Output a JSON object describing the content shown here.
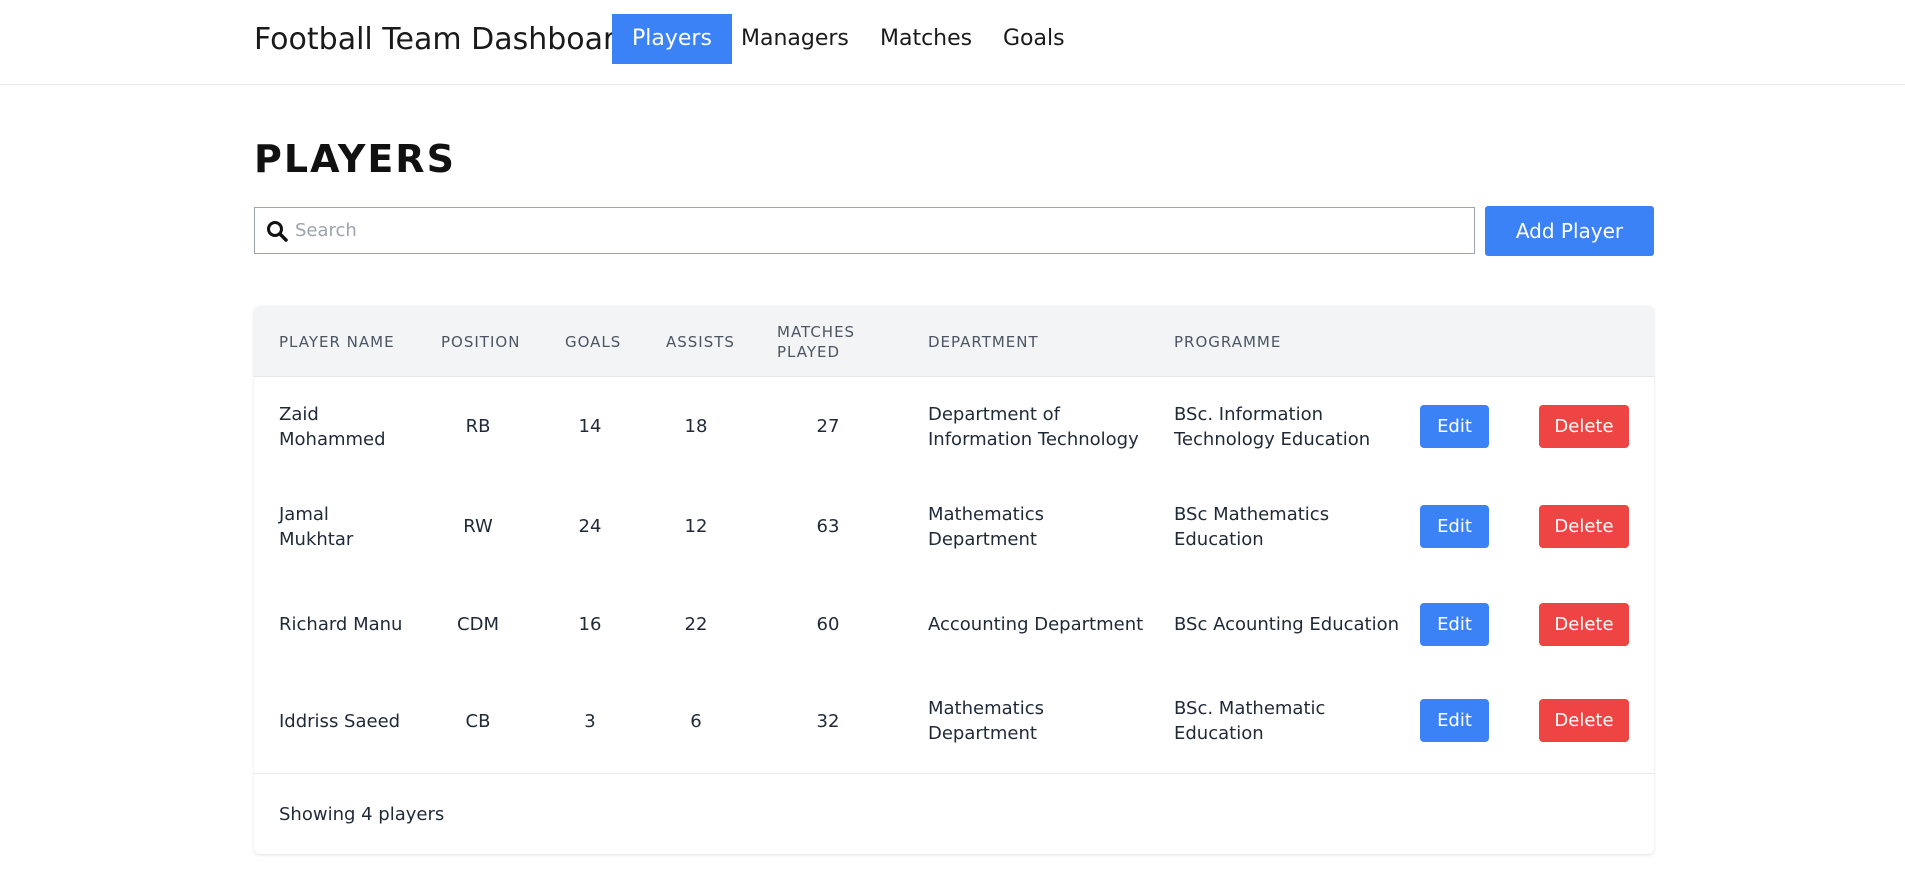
{
  "nav": {
    "brand": "Football Team Dashboard",
    "items": [
      {
        "label": "Players",
        "active": true
      },
      {
        "label": "Managers",
        "active": false
      },
      {
        "label": "Matches",
        "active": false
      },
      {
        "label": "Goals",
        "active": false
      }
    ]
  },
  "page": {
    "title": "PLAYERS"
  },
  "search": {
    "placeholder": "Search",
    "value": ""
  },
  "toolbar": {
    "add_label": "Add Player"
  },
  "table": {
    "headers": {
      "name": "PLAYER NAME",
      "position": "POSITION",
      "goals": "GOALS",
      "assists": "ASSISTS",
      "matches_line1": "MATCHES",
      "matches_line2": "PLAYED",
      "department": "DEPARTMENT",
      "programme": "PROGRAMME"
    },
    "rows": [
      {
        "name1": "Zaid",
        "name2": "Mohammed",
        "position": "RB",
        "goals": "14",
        "assists": "18",
        "matches": "27",
        "dept1": "Department of",
        "dept2": "Information Technology",
        "prog1": "BSc. Information",
        "prog2": "Technology Education",
        "edit": "Edit",
        "delete": "Delete"
      },
      {
        "name1": "Jamal",
        "name2": "Mukhtar",
        "position": "RW",
        "goals": "24",
        "assists": "12",
        "matches": "63",
        "dept1": "Mathematics",
        "dept2": "Department",
        "prog1": "BSc Mathematics",
        "prog2": "Education",
        "edit": "Edit",
        "delete": "Delete"
      },
      {
        "name1": "Richard Manu",
        "name2": "",
        "position": "CDM",
        "goals": "16",
        "assists": "22",
        "matches": "60",
        "dept1": "Accounting Department",
        "dept2": "",
        "prog1": "BSc Acounting Education",
        "prog2": "",
        "edit": "Edit",
        "delete": "Delete"
      },
      {
        "name1": "Iddriss Saeed",
        "name2": "",
        "position": "CB",
        "goals": "3",
        "assists": "6",
        "matches": "32",
        "dept1": "Mathematics",
        "dept2": "Department",
        "prog1": "BSc. Mathematic",
        "prog2": "Education",
        "edit": "Edit",
        "delete": "Delete"
      }
    ],
    "footer": "Showing 4 players"
  },
  "colors": {
    "primary": "#3b82f6",
    "danger": "#ef4444",
    "header_bg": "#f3f4f6"
  },
  "icons": {
    "search": "search-icon"
  }
}
